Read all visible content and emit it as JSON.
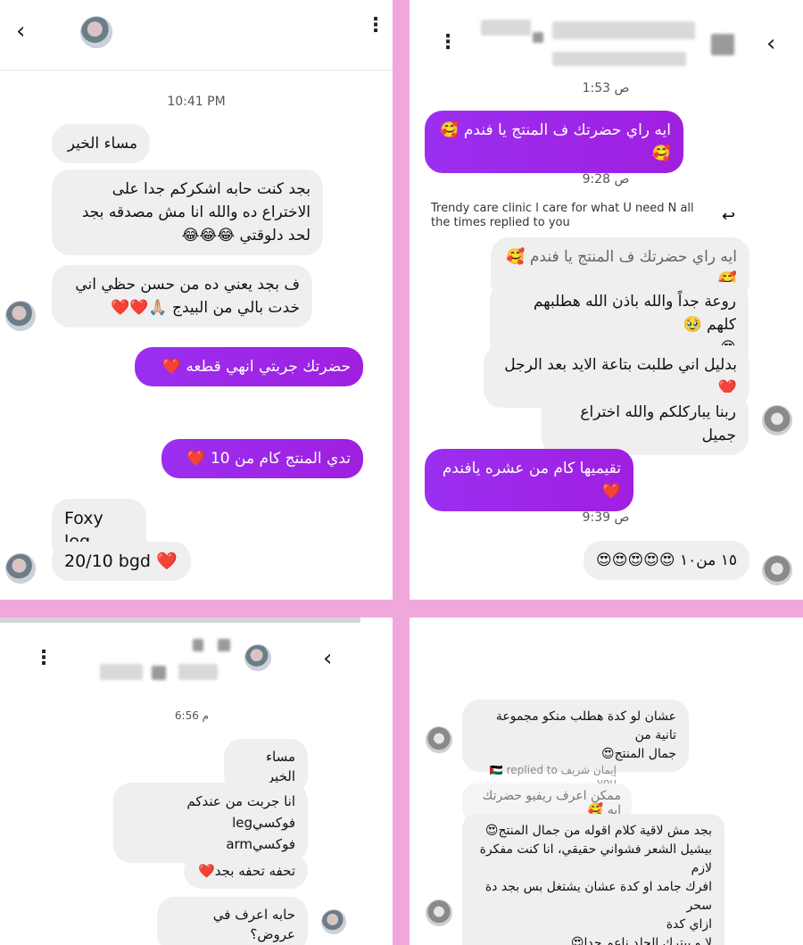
{
  "panel1": {
    "time": "10:41 PM",
    "messages": [
      "مساء الخير",
      "بجد كنت حابه اشكركم جدا على\nالاختراع ده والله انا مش مصدقه بجد\nلحد دلوقتي 😂😂😂",
      "ف بجد يعني ده من حسن حظي اني\nخدت بالي من البيدج 🙏🏼❤️❤️",
      "حضرتك جربتي انهي قطعه ❤️",
      "تدي المنتج كام من 10 ❤️",
      "Foxy leg",
      "20/10 bgd ❤️"
    ]
  },
  "panel2": {
    "time1": "1:53 ص",
    "time2": "9:28 ص",
    "time3": "9:39 ص",
    "reply_text": "Trendy care clinic l care for what U need  N all the times replied to you",
    "messages": [
      "ايه راي حضرتك ف المنتج يا فندم 🥰🥰",
      "ايه راي حضرتك ف المنتج يا فندم 🥰🥰",
      "روعة جداً والله  باذن الله هطلبهم كلهم 🥹\n😍",
      "بدليل اني طلبت  بتاعة الايد بعد الرجل ❤️",
      "ربنا يباركلكم والله اختراع جميل",
      "تقيميها كام من عشره يافندم ❤️",
      "١٥ من١٠ 😍😍😍😍😍"
    ]
  },
  "panel3": {
    "time": "6:56 م",
    "messages": [
      "مساء الخير",
      "انا جربت من عندكم فوكسيleg\nفوكسيarm",
      "تحفه تحفه بجد❤️",
      "حابه اعرف في عروض؟"
    ]
  },
  "panel4": {
    "reply_tag": "إيمان شريف 🇵🇸 replied to you",
    "quoted": "ممكن اعرف ريفيو حضرتك ايه 🥰",
    "messages": [
      "عشان لو كدة هطلب منكو مجموعة تانية من\nجمال المنتج😍",
      "بجد مش لاقية كلام اقوله من جمال المنتج😍\nبيشيل الشعر فشواني حقيقي، انا كنت مفكرة لازم\nافرك جامد او كدة عشان يشتغل بس بجد دة سحر\nازاي كدة\nلا و بيترك الجلد ناعم جدا😍"
    ]
  },
  "colors": {
    "accent": "#9b2ff0",
    "divider_pink": "#f0a8dc"
  }
}
